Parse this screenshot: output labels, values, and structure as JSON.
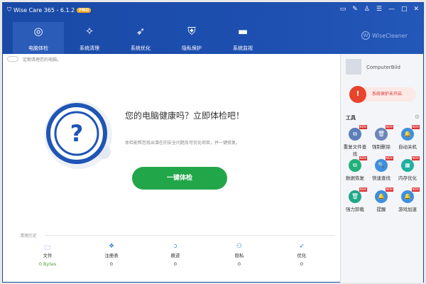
{
  "window": {
    "title": "Wise Care 365 - 6.1.2",
    "badge": "PRO"
  },
  "nav": [
    {
      "label": "电脑体检",
      "icon": "target-icon"
    },
    {
      "label": "系统清理",
      "icon": "broom-icon"
    },
    {
      "label": "系统优化",
      "icon": "rocket-icon"
    },
    {
      "label": "隐私保护",
      "icon": "shield-lock-icon"
    },
    {
      "label": "系统监视",
      "icon": "monitor-icon"
    }
  ],
  "brand": "WiseCleaner",
  "brand_mark": "W",
  "main": {
    "toggle_label": "定期清理您的电脑。",
    "headline": "您的电脑健康吗？立即体检吧！",
    "subtitle": "体检能帮您找出潜在的安全问题及可优化项目，并一键修复。",
    "scan_button": "一键体检",
    "hero_symbol": "?"
  },
  "history": {
    "title": "清理历史",
    "items": [
      {
        "label": "文件",
        "value": "0 Bytes"
      },
      {
        "label": "注册表",
        "value": "0"
      },
      {
        "label": "痕迹",
        "value": "0"
      },
      {
        "label": "隐私",
        "value": "0"
      },
      {
        "label": "优化",
        "value": "0"
      }
    ]
  },
  "side": {
    "username": "ComputerBild",
    "protection": "系统保护未开启",
    "tools_title": "工具",
    "new_badge": "NEW",
    "tools": [
      {
        "label": "重复文件查找",
        "color": "#5b7fb8"
      },
      {
        "label": "强制删除",
        "color": "#6a87b8"
      },
      {
        "label": "自动关机",
        "color": "#3d8fe0"
      },
      {
        "label": "数据恢复",
        "color": "#22b07a"
      },
      {
        "label": "快速查找",
        "color": "#3d8fe0"
      },
      {
        "label": "内存优化",
        "color": "#1fb0a0"
      },
      {
        "label": "强力卸载",
        "color": "#1fa888"
      },
      {
        "label": "提醒",
        "color": "#3d8fe0"
      },
      {
        "label": "游戏加速",
        "color": "#3d8fe0"
      }
    ]
  },
  "colors": {
    "header": "#1a4aa6",
    "accent_green": "#22a64a",
    "alert_red": "#e8432d"
  }
}
